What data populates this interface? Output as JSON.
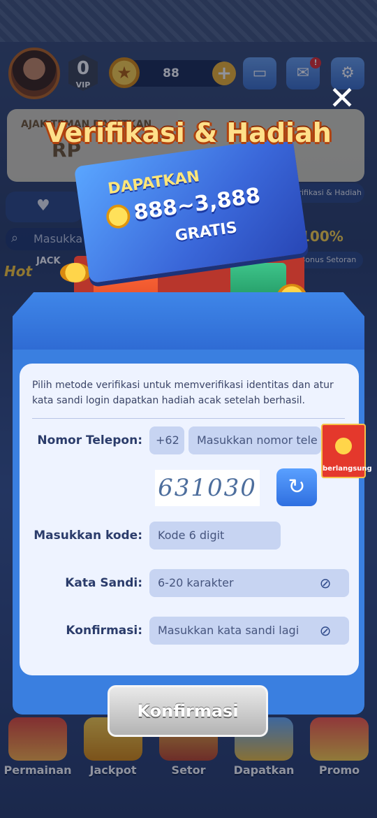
{
  "topbar": {
    "vip_level": "0",
    "vip_label": "VIP",
    "coins": "88",
    "mail_badge": "!"
  },
  "background": {
    "banner_text": "AJAK TEMAN DAPATKAN",
    "banner_currency": "RP",
    "side_tab_1": "Verifikasi & Hadiah",
    "search_placeholder": "Masukka",
    "percent_text": "100%",
    "side_tab_2": "Bonus Setoran",
    "jackpot_text": "JACK",
    "hot_label": "Hot"
  },
  "modal": {
    "title": "Verifikasi & Hadiah",
    "card_get": "DAPATKAN",
    "card_amount": "888~3,888",
    "card_free": "GRATIS",
    "description": "Pilih metode verifikasi untuk memverifikasi identitas dan atur kata sandi login dapatkan hadiah acak setelah berhasil.",
    "phone_label": "Nomor Telepon:",
    "country_code": "+62",
    "phone_placeholder": "Masukkan nomor tele",
    "captcha_text": "631030",
    "code_label": "Masukkan kode:",
    "code_placeholder": "Kode 6 digit",
    "password_label": "Kata Sandi:",
    "password_placeholder": "6-20 karakter",
    "confirm_label": "Konfirmasi:",
    "confirm_placeholder": "Masukkan kata sandi lagi",
    "confirm_button": "Konfirmasi",
    "side_promo": "berlangsung"
  },
  "bottom_nav": [
    {
      "label": "Permainan"
    },
    {
      "label": "Jackpot"
    },
    {
      "label": "Setor"
    },
    {
      "label": "Dapatkan"
    },
    {
      "label": "Promo"
    }
  ],
  "colors": {
    "accent": "#3a7fe0",
    "title_gold": "#ffe08a",
    "panel_bg": "#eef3ff"
  },
  "icons": [
    "wallet-icon",
    "mail-icon",
    "gear-icon",
    "close-icon",
    "eye-off-icon",
    "refresh-icon",
    "star-coin-icon",
    "plus-icon",
    "heart-icon",
    "search-icon"
  ]
}
